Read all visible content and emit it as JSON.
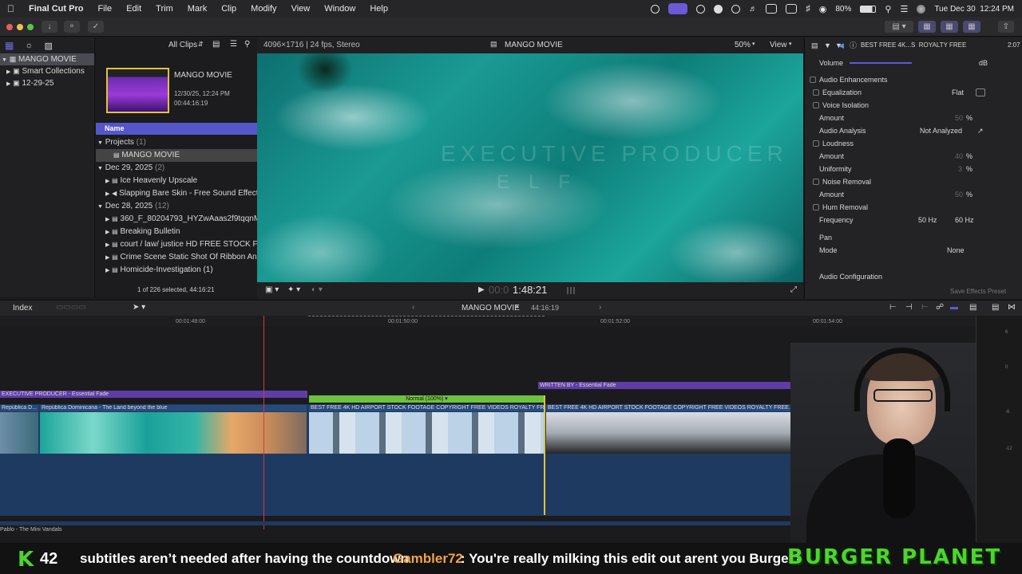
{
  "menubar": {
    "app": "Final Cut Pro",
    "items": [
      "File",
      "Edit",
      "Trim",
      "Mark",
      "Clip",
      "Modify",
      "View",
      "Window",
      "Help"
    ],
    "battery": "80%",
    "datetime": "Tue Dec 30  12:24 PM"
  },
  "library": {
    "items": [
      {
        "label": "MANGO MOVIE",
        "selected": true
      },
      {
        "label": "Smart Collections"
      },
      {
        "label": "12-29-25"
      }
    ]
  },
  "browser": {
    "filter": "All Clips",
    "project_title": "MANGO MOVIE",
    "project_date": "12/30/25, 12:24 PM",
    "project_duration": "00:44:16:19",
    "column_name": "Name",
    "groups": [
      {
        "label": "Projects",
        "count": "(1)",
        "items": [
          "MANGO MOVIE"
        ]
      },
      {
        "label": "Dec 29, 2025",
        "count": "(2)",
        "items": [
          "Ice Heavenly Upscale",
          "Slapping Bare Skin - Free Sound Effects"
        ]
      },
      {
        "label": "Dec 28, 2025",
        "count": "(12)",
        "items": [
          "360_F_80204793_HYZwAaas2f9tqqnMN",
          "Breaking Bulletin",
          "court / law/ justice HD FREE STOCK FOO",
          "Crime Scene Static Shot Of Ribbon And S",
          "Homicide-Investigation (1)"
        ]
      }
    ],
    "selection_status": "1 of 226 selected, 44:16:21"
  },
  "viewer": {
    "format": "4096×1716 | 24 fps, Stereo",
    "title": "MANGO MOVIE",
    "zoom": "50%",
    "view_label": "View",
    "watermark_line1": "EXECUTIVE PRODUCER",
    "watermark_line2": "ELF",
    "timecode_dim": "00:0",
    "timecode": "1:48:21"
  },
  "inspector": {
    "clip_title": "BEST FREE 4K...S  ROYALTY FREE",
    "duration": "2:07",
    "volume_label": "Volume",
    "volume_value": "dB",
    "audio_enhancements": "Audio Enhancements",
    "equalization": "Equalization",
    "equalization_value": "Flat",
    "voice_isolation": "Voice Isolation",
    "amount_label": "Amount",
    "vi_amount": "50",
    "pct": "%",
    "audio_analysis": "Audio Analysis",
    "audio_analysis_value": "Not Analyzed",
    "loudness": "Loudness",
    "loud_amount": "40",
    "uniformity": "Uniformity",
    "uniformity_value": "3",
    "noise_removal": "Noise Removal",
    "nr_amount": "50",
    "hum_removal": "Hum Removal",
    "frequency": "Frequency",
    "freq_50": "50 Hz",
    "freq_60": "60 Hz",
    "pan": "Pan",
    "mode": "Mode",
    "mode_value": "None",
    "audio_config": "Audio Configuration",
    "save_preset": "Save Effects Preset"
  },
  "timeline": {
    "index_label": "Index",
    "project": "MANGO MOVIE",
    "duration": "44:16:19",
    "ruler": [
      "00:01:48:00",
      "00:01:50:00",
      "00:01:52:00",
      "00:01:54:00"
    ],
    "title_bars": [
      "EXECUTIVE PRODUCER - Essential Fade",
      "WRITTEN BY - Essential Fade"
    ],
    "speed_label": "Normal (100%)",
    "clip_labels": [
      "República D...",
      "República Dominicana - The Land beyond the blue",
      "BEST FREE 4K   HD AIRPORT STOCK FOOTAGE   COPYRIGHT FREE VIDEOS   ROYALTY FREE",
      "BEST FREE 4K   HD AIRPORT STOCK FOOTAGE   COPYRIGHT FREE VIDEOS   ROYALTY FREE."
    ],
    "audio_label": "Pablo - The Mini Vandals"
  },
  "ticker": {
    "count": "42",
    "message": "subtitles aren’t needed after having the countdown",
    "user": "Gambler72",
    "chat": ": You're really milking this edit out arent you Burger?",
    "brand": "BURGER PLANET"
  },
  "colors": {
    "accent_purple": "#5e3da6",
    "title_bar_purple": "#5c3fa8",
    "speed_green": "#6cc33c",
    "brand_green": "#4bd62c",
    "playhead_red": "#d23a3a",
    "viewer_teal": "#0e7d79"
  }
}
